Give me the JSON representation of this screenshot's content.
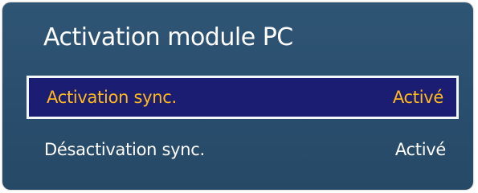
{
  "panel": {
    "title": "Activation module PC"
  },
  "items": [
    {
      "label": "Activation sync.",
      "value": "Activé",
      "selected": true
    },
    {
      "label": "Désactivation sync.",
      "value": "Activé",
      "selected": false
    }
  ],
  "colors": {
    "panel_background": "#2b4f6e",
    "selected_row_background": "#1b1d72",
    "selected_text": "#ffb81e",
    "selected_border": "#f3f6fa",
    "text": "#ffffff"
  }
}
